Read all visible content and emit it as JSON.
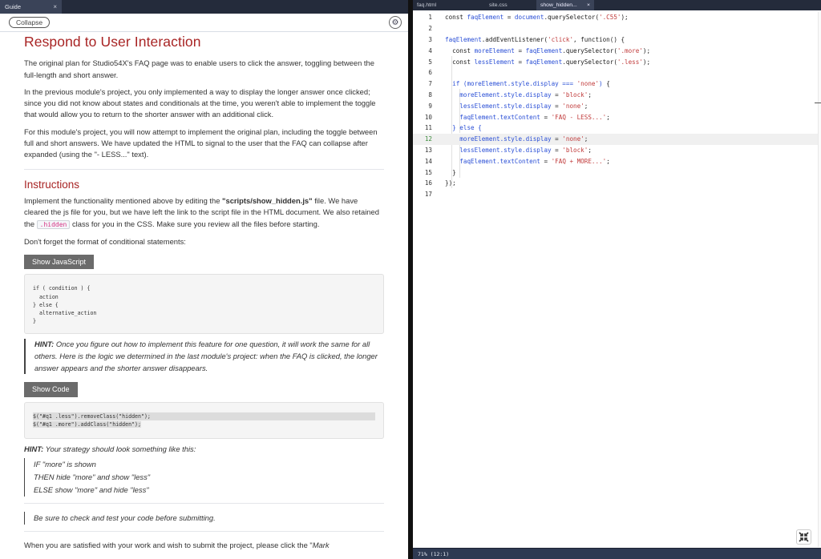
{
  "guide_panel": {
    "tab_label": "Guide",
    "tab_close": "×",
    "collapse_label": "Collapse",
    "settings_icon": "gear-icon",
    "title": "Respond to User Interaction",
    "intro_paragraphs": [
      "The original plan for Studio54X's FAQ page was to enable users to click the answer, toggling between the full-length and short answer.",
      "In the previous module's project, you only implemented a way to display the longer answer once clicked; since you did not know about states and conditionals at the time, you weren't able to implement the toggle that would allow you to return to the shorter answer with an additional click.",
      "For this module's project, you will now attempt to implement the original plan, including the toggle between full and short answers. We have updated the HTML to signal to the user that the FAQ can collapse after expanded (using the \"- LESS...\" text)."
    ],
    "instructions_heading": "Instructions",
    "instr_p1_before": "Implement the functionality mentioned above by editing the ",
    "instr_p1_bold": "\"scripts/show_hidden.js\"",
    "instr_p1_after": " file. We have cleared the js file for you, but we have left the link to the script file in the HTML document. We also retained the ",
    "instr_p1_code": ".hidden",
    "instr_p1_end": " class for you in the CSS. Make sure you review all the files before starting.",
    "instr_p2": "Don't forget the format of conditional statements:",
    "show_js_label": "Show JavaScript",
    "conditional_code": [
      "if ( condition ) {",
      "  action",
      "} else {",
      "  alternative_action",
      "}"
    ],
    "hint1_label": "HINT:",
    "hint1_text": " Once you figure out how to implement this feature for one question, it will work the same for all others. Here is the logic we determined in the last module's project: when the FAQ is clicked, the longer answer appears and the shorter answer disappears.",
    "show_code_label": "Show Code",
    "jquery_code": [
      "$(\"#q1 .less\").removeClass(\"hidden\");",
      "$(\"#q1 .more\").addClass(\"hidden\");"
    ],
    "hint2_label": "HINT:",
    "hint2_text": " Your strategy should look something like this:",
    "strategy_lines": [
      "IF \"more\" is shown",
      "THEN hide \"more\" and show \"less\"",
      "ELSE show \"more\" and hide \"less\""
    ],
    "reminder": "Be sure to check and test your code before submitting.",
    "final_line_before": "When you are satisfied with your work and wish to submit the project, please click the \"",
    "final_line_italic": "Mark"
  },
  "editor_panel": {
    "tabs": [
      {
        "label": "faq.html",
        "active": false
      },
      {
        "label": "site.css",
        "active": false
      },
      {
        "label": "show_hidden...",
        "active": true,
        "close": "×"
      }
    ],
    "active_line": 12,
    "status": "71%  (12:1)",
    "minimize_icon": "collapse-arrows-icon"
  }
}
